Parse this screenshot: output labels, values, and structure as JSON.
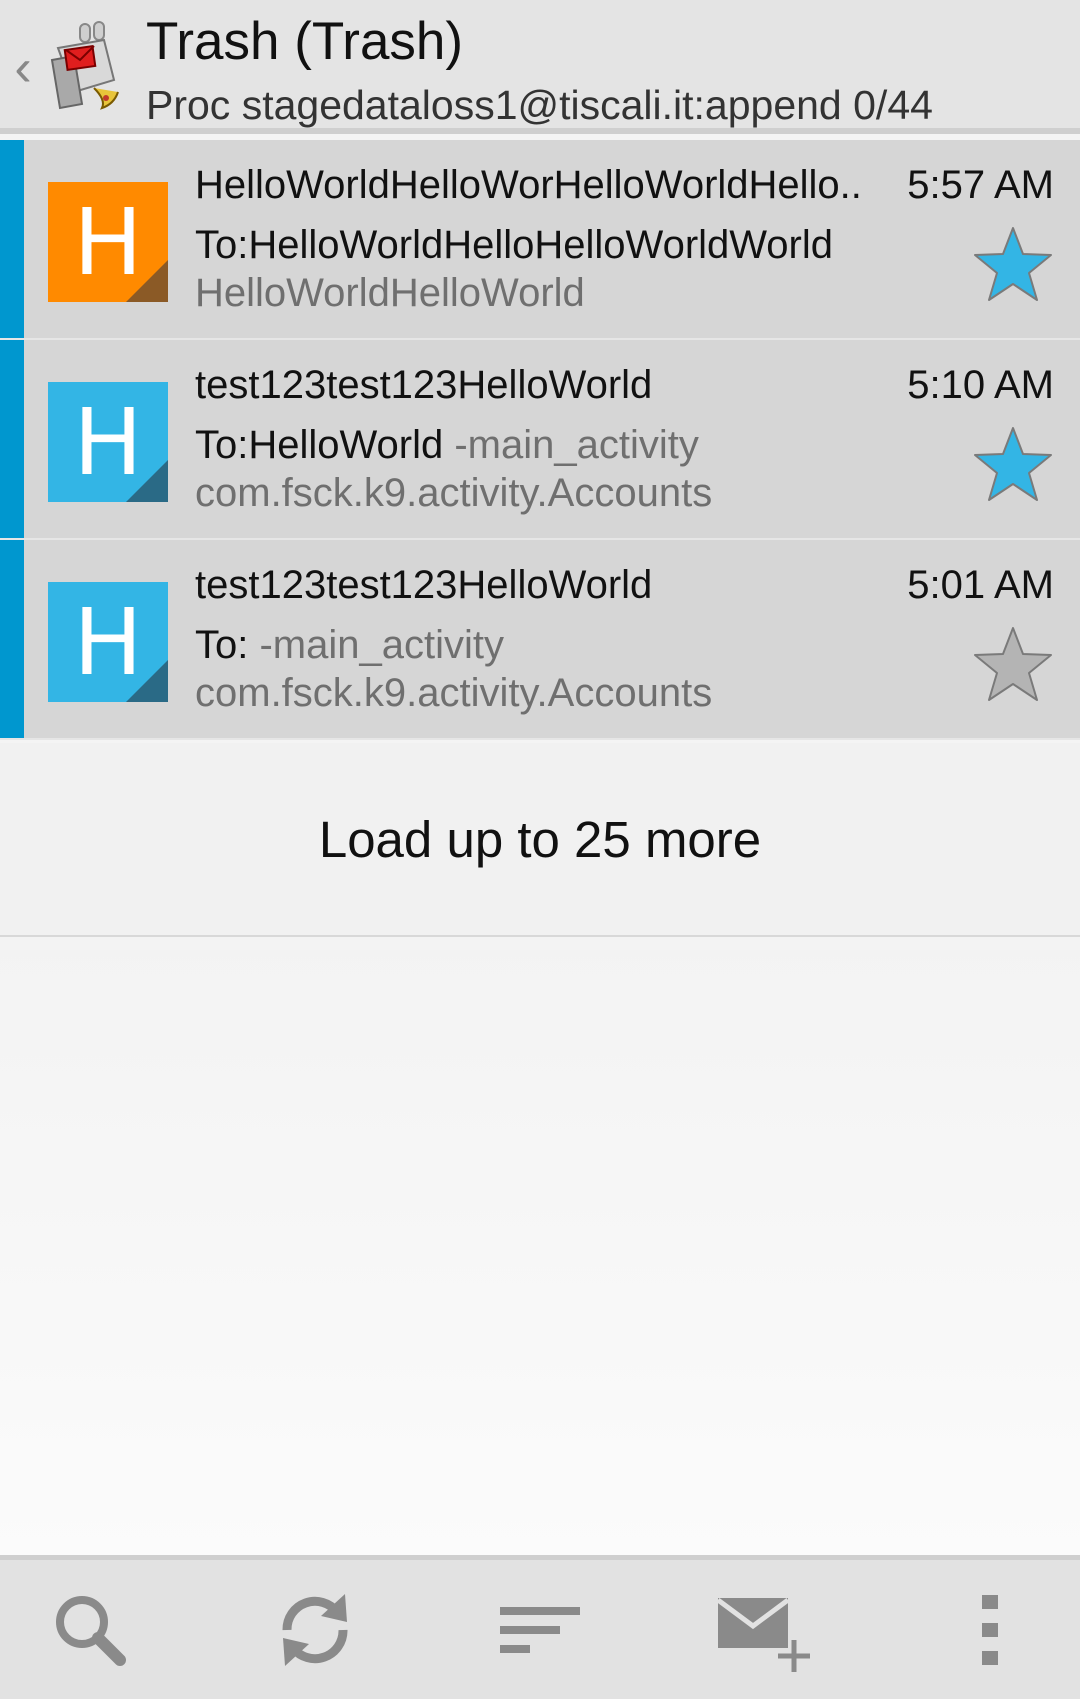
{
  "header": {
    "back_glyph": "‹",
    "app_icon": "k9-mail-dog-icon",
    "title": "Trash (Trash)",
    "subtitle": "Proc stagedataloss1@tiscali.it:append 0/44"
  },
  "messages": [
    {
      "sender": "HelloWorldHelloWorHelloWorldHello..",
      "time": "5:57 AM",
      "to": "To:HelloWorldHelloHelloWorldWorld",
      "preview": "",
      "line3": "HelloWorldHelloWorld",
      "avatar_letter": "H",
      "avatar_color": "#ff8a00",
      "avatar_fold_color": "#8b5a26",
      "starred": true
    },
    {
      "sender": "test123test123HelloWorld",
      "time": "5:10 AM",
      "to": "To:HelloWorld",
      "preview": " -main_activity",
      "line3": "com.fsck.k9.activity.Accounts",
      "avatar_letter": "H",
      "avatar_color": "#33b5e5",
      "avatar_fold_color": "#2a6a86",
      "starred": true
    },
    {
      "sender": "test123test123HelloWorld",
      "time": "5:01 AM",
      "to": "To:",
      "preview": " -main_activity",
      "line3": "com.fsck.k9.activity.Accounts",
      "avatar_letter": "H",
      "avatar_color": "#33b5e5",
      "avatar_fold_color": "#2a6a86",
      "starred": false
    }
  ],
  "load_more": "Load up to 25 more",
  "toolbar": {
    "icons": [
      "search-icon",
      "refresh-icon",
      "sort-icon",
      "compose-icon",
      "overflow-menu-icon"
    ]
  },
  "colors": {
    "selection_bar": "#0097cf",
    "star_active": "#33b5e5",
    "star_inactive": "#b4b4b4"
  }
}
